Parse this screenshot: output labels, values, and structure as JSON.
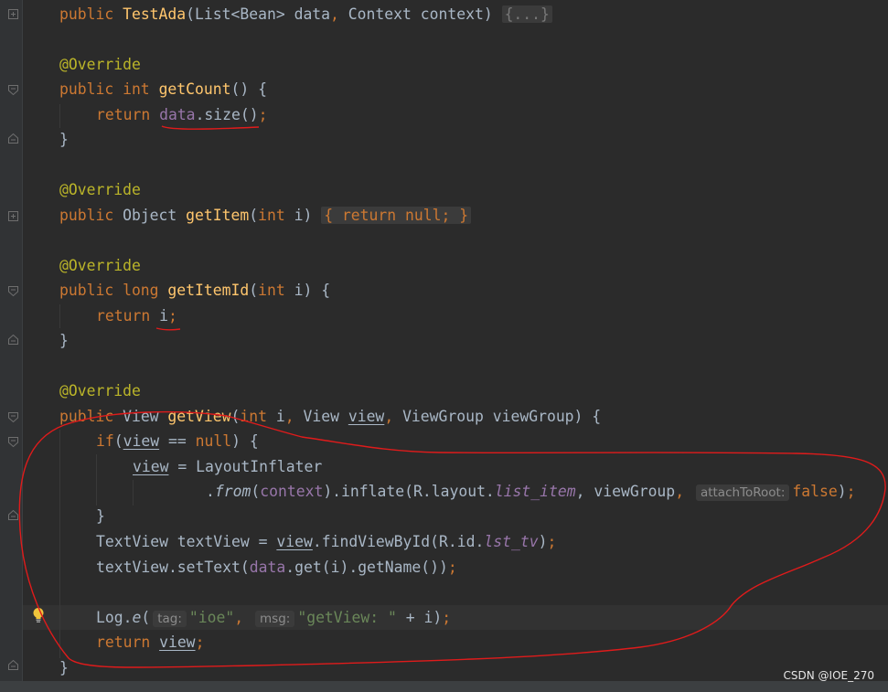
{
  "code": {
    "line1": {
      "a": "public ",
      "name": "TestAda",
      "b": "(List<Bean> data",
      "comma": ", ",
      "c": "Context context) ",
      "fold": "{...}"
    },
    "line2": {
      "ann": "@Override"
    },
    "line3": {
      "a": "public int ",
      "name": "getCount",
      "b": "() {"
    },
    "line4": {
      "kw": "return ",
      "field": "data",
      "b": ".size()",
      "semi": ";"
    },
    "line5": {
      "a": "}"
    },
    "line6": {
      "ann": "@Override"
    },
    "line7": {
      "a": "public ",
      "b": "Object ",
      "name": "getItem",
      "c": "(",
      "kw_int": "int ",
      "d": "i) ",
      "fold": "{ return null; }"
    },
    "line8": {
      "ann": "@Override"
    },
    "line9": {
      "a": "public long ",
      "name": "getItemId",
      "b": "(",
      "kw_int": "int ",
      "c": "i) {"
    },
    "line10": {
      "kw": "return ",
      "b": "i",
      "semi": ";"
    },
    "line11": {
      "a": "}"
    },
    "line12": {
      "ann": "@Override"
    },
    "line13": {
      "a": "public ",
      "b": "View ",
      "name": "getView",
      "c": "(",
      "kw_int": "int ",
      "d": "i",
      "comma1": ", ",
      "e": "View ",
      "f": "view",
      "comma2": ", ",
      "g": "ViewGroup viewGroup) {"
    },
    "line14": {
      "kw": "if",
      "a": "(",
      "b": "view",
      "c": " == ",
      "kw_null": "null",
      "d": ") {"
    },
    "line15": {
      "a": "view",
      "b": " = LayoutInflater"
    },
    "line16": {
      "a": ".",
      "from": "from",
      "b": "(",
      "ctx": "context",
      "c": ").inflate(R.layout.",
      "item": "list_item",
      "d": ", viewGroup",
      "comma": ", ",
      "hint": "attachToRoot:",
      "kw_false": "false",
      "e": ")",
      "semi": ";"
    },
    "line17": {
      "a": "}"
    },
    "line18": {
      "a": "TextView textView = ",
      "b": "view",
      "c": ".findViewById(R.id.",
      "id": "lst_tv",
      "d": ")",
      "semi": ";"
    },
    "line19": {
      "a": "textView.setText(",
      "field": "data",
      "b": ".get(i).getName())",
      "semi": ";"
    },
    "line20": {
      "a": "Log.",
      "e": "e",
      "b": "(",
      "hint_tag": "tag:",
      "str1": "\"ioe\"",
      "comma": ", ",
      "hint_msg": "msg:",
      "str2": "\"getView: \"",
      "c": " + i)",
      "semi": ";"
    },
    "line21": {
      "kw": "return ",
      "a": "view",
      "semi": ";"
    },
    "line22": {
      "a": "}"
    }
  },
  "watermark": "CSDN @IOE_270",
  "colors": {
    "background": "#2b2b2b",
    "keyword": "#cc7832",
    "method": "#ffc66d",
    "annotation": "#bbb529",
    "field": "#9876aa",
    "string": "#6a8759",
    "text": "#a9b7c6",
    "markup": "#e01b1b"
  },
  "icons": {
    "bulb": "lightbulb-icon",
    "fold": "fold-marker-icon"
  }
}
